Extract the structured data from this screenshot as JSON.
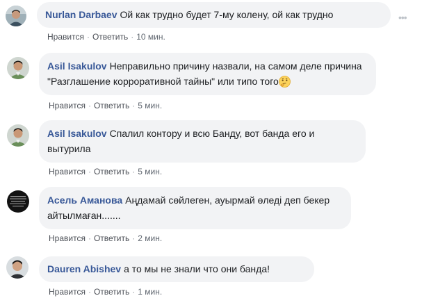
{
  "comments": [
    {
      "author": "Nurlan Darbaev",
      "text": "Ой как трудно будет 7-му колену, ой как трудно",
      "like": "Нравится",
      "reply": "Ответить",
      "time": "10 мин.",
      "avatar_icon": "avatar-photo-icon"
    },
    {
      "author": "Asil Isakulov",
      "text": "Неправильно причину назвали, на самом деле причина \"Разглашение корроративной тайны\" или типо того",
      "like": "Нравится",
      "reply": "Ответить",
      "time": "5 мин.",
      "avatar_icon": "avatar-photo-icon",
      "emoji_icon": "thinking-face-emoji-icon"
    },
    {
      "author": "Asil Isakulov",
      "text": "Спалил контору и всю Банду, вот банда его и вытурила",
      "like": "Нравится",
      "reply": "Ответить",
      "time": "5 мин.",
      "avatar_icon": "avatar-photo-icon"
    },
    {
      "author": "Асель Аманова",
      "text": "Аңдамай сөйлеген, ауырмай өледі деп бекер айтылмаған.......",
      "like": "Нравится",
      "reply": "Ответить",
      "time": "2 мин.",
      "avatar_icon": "avatar-dark-text-icon"
    },
    {
      "author": "Dauren Abishev",
      "text": "а то мы не знали что они банда!",
      "like": "Нравится",
      "reply": "Ответить",
      "time": "1 мин.",
      "avatar_icon": "avatar-photo-icon"
    }
  ],
  "more_icon": "more-options-icon",
  "colors": {
    "bubble": "#f2f3f5",
    "author": "#385898",
    "action": "#4b4f56",
    "time": "#606770"
  }
}
